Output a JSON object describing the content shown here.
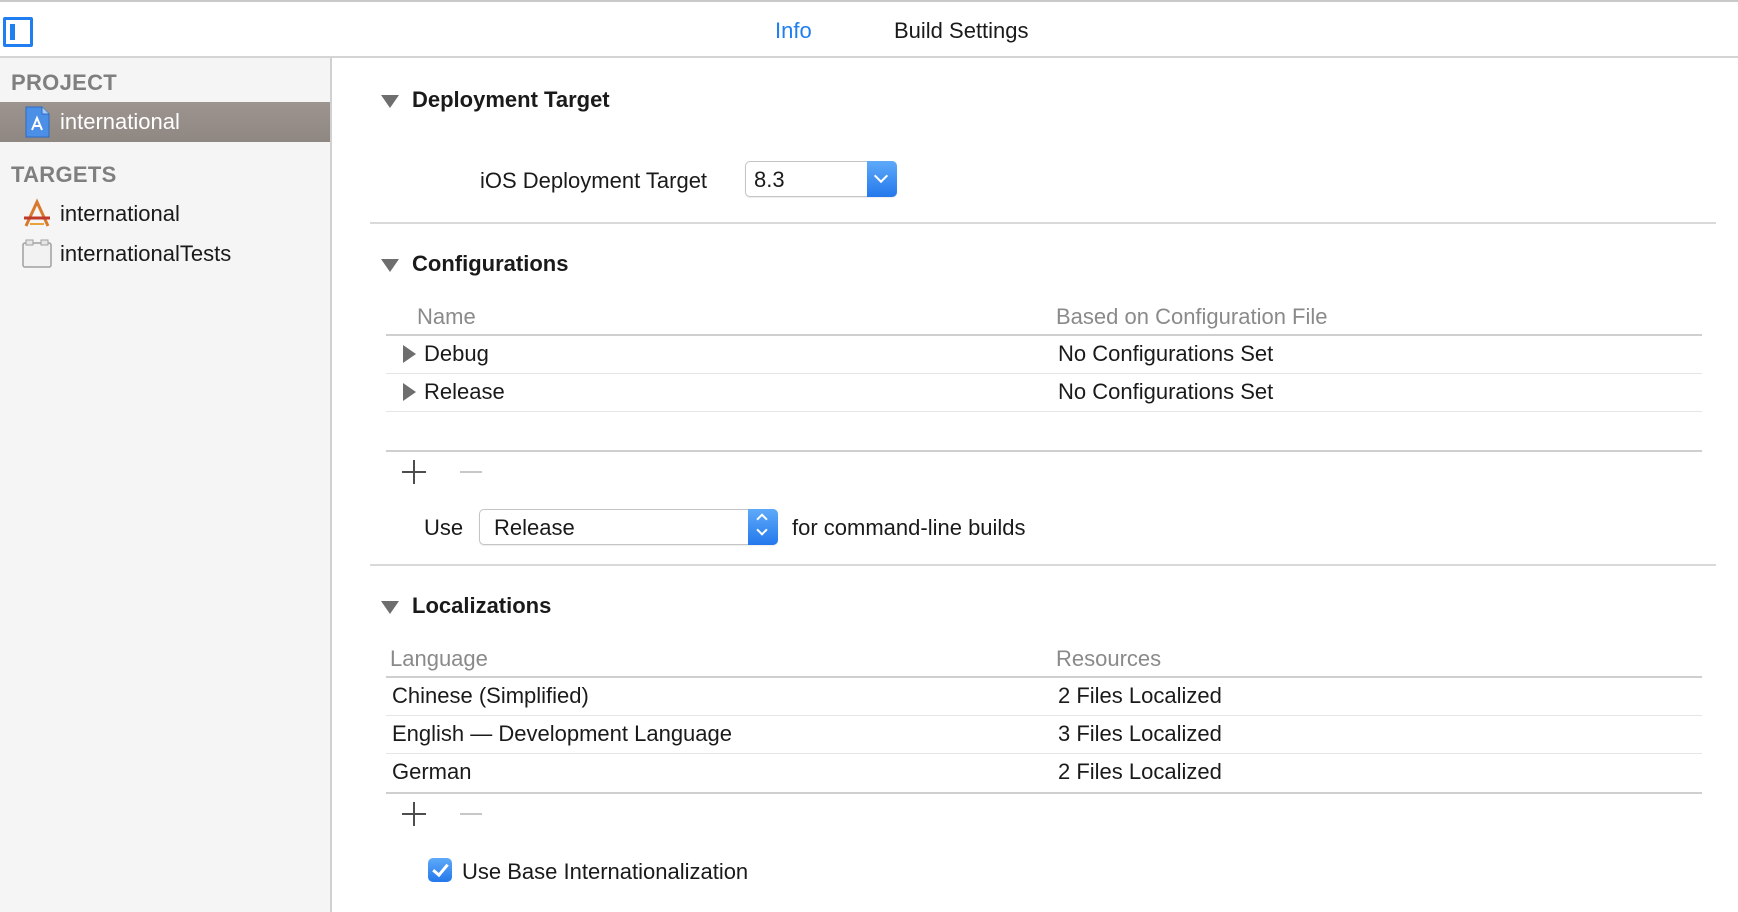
{
  "tabs": {
    "info": "Info",
    "build_settings": "Build Settings"
  },
  "sidebar": {
    "project_heading": "PROJECT",
    "project_item": "international",
    "targets_heading": "TARGETS",
    "targets": [
      "international",
      "internationalTests"
    ]
  },
  "deployment": {
    "title": "Deployment Target",
    "label": "iOS Deployment Target",
    "value": "8.3"
  },
  "configurations": {
    "title": "Configurations",
    "col_name": "Name",
    "col_file": "Based on Configuration File",
    "rows": [
      {
        "name": "Debug",
        "file": "No Configurations Set"
      },
      {
        "name": "Release",
        "file": "No Configurations Set"
      }
    ],
    "use_label": "Use",
    "use_value": "Release",
    "use_suffix": "for command-line builds"
  },
  "localizations": {
    "title": "Localizations",
    "col_language": "Language",
    "col_resources": "Resources",
    "rows": [
      {
        "language": "Chinese (Simplified)",
        "resources": "2 Files Localized"
      },
      {
        "language": "English — Development Language",
        "resources": "3 Files Localized"
      },
      {
        "language": "German",
        "resources": "2 Files Localized"
      }
    ],
    "base_internationalization": "Use Base Internationalization",
    "base_checked": true
  },
  "colors": {
    "accent": "#1f7ef0",
    "selection": "#968d88"
  }
}
